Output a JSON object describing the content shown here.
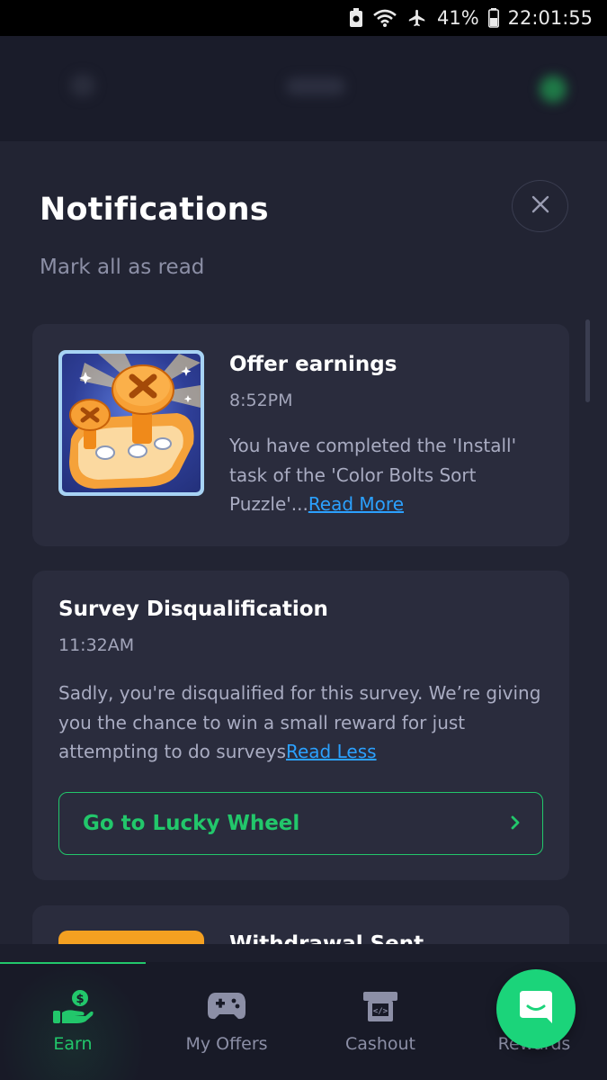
{
  "status_bar": {
    "battery": "41%",
    "time": "22:01:55"
  },
  "sheet": {
    "title": "Notifications",
    "mark_all_read": "Mark all as read"
  },
  "notifications": [
    {
      "title": "Offer earnings",
      "time": "8:52PM",
      "body": "You have completed the 'Install' task of the 'Color Bolts Sort Puzzle'...",
      "link": "Read More",
      "icon": "color-bolts-sort-puzzle-icon"
    },
    {
      "title": "Survey Disqualification",
      "time": "11:32AM",
      "body": "Sadly, you're disqualified for this survey. We’re giving you the chance to win a small reward for just attempting to do surveys",
      "link": "Read Less",
      "action": "Go to Lucky Wheel"
    },
    {
      "title": "Withdrawal Sent"
    }
  ],
  "bottom_nav": {
    "items": [
      {
        "label": "Earn",
        "icon": "money-hand-icon",
        "active": true
      },
      {
        "label": "My Offers",
        "icon": "gamepad-icon",
        "active": false
      },
      {
        "label": "Cashout",
        "icon": "cashout-icon",
        "active": false
      },
      {
        "label": "Rewards",
        "icon": "rewards-icon",
        "active": false
      }
    ]
  },
  "colors": {
    "accent": "#22c76b",
    "link": "#2ba1ff",
    "sheet_bg": "#222433",
    "card_bg": "#2a2c3d"
  }
}
